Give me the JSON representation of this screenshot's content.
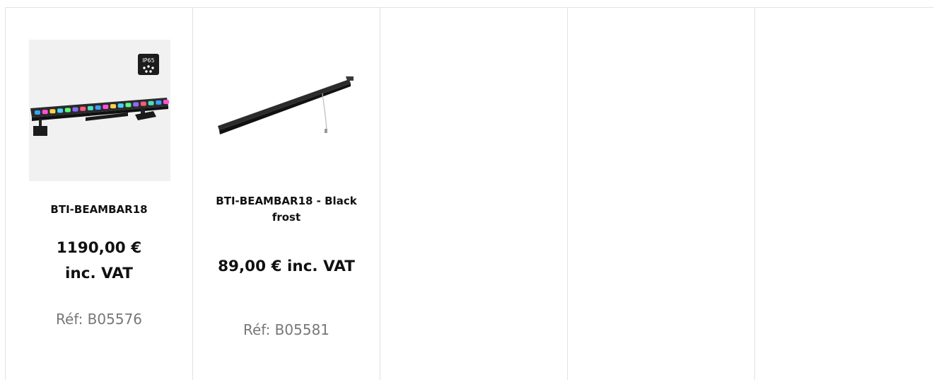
{
  "products": [
    {
      "name": "BTI-BEAMBAR18",
      "price": "1190,00 € inc. VAT",
      "ref": "Réf: B05576",
      "badge": "IP65",
      "image_icon": "led-beam-bar-image"
    },
    {
      "name": "BTI-BEAMBAR18 - Black frost",
      "price": "89,00 € inc. VAT",
      "ref": "Réf: B05581",
      "image_icon": "black-frost-diffuser-image"
    }
  ],
  "colors": {
    "grid_line": "#e2e2e2",
    "text": "#111111",
    "ref_text": "#777777"
  }
}
